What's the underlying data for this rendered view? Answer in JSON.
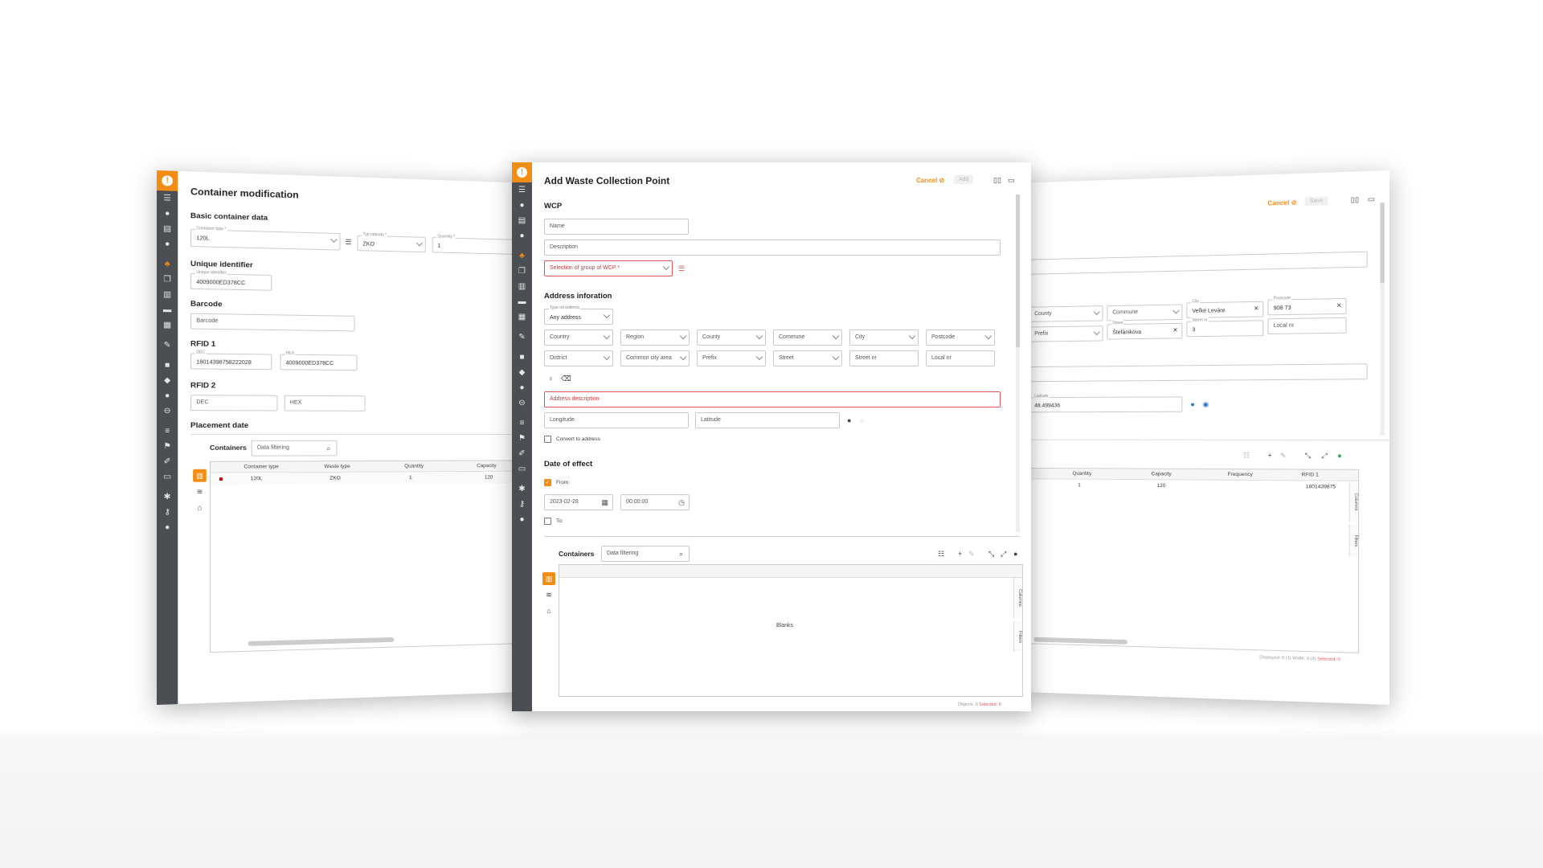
{
  "colors": {
    "accent": "#f28c13",
    "rail": "#4b4f53",
    "error": "#e05555"
  },
  "rail_icons": [
    "list-icon",
    "globe-icon",
    "document-icon",
    "info-icon",
    "waste-icon",
    "copy-icon",
    "bin-icon",
    "archive-icon",
    "calendar-icon",
    "magic-icon",
    "camera-icon",
    "tag-icon",
    "chat-icon",
    "minus-circle-icon",
    "sliders-icon",
    "flag-icon",
    "hammer-icon",
    "id-card-icon",
    "gear-icon",
    "key-icon",
    "user-icon"
  ],
  "left": {
    "title": "Container modification",
    "basic_section": "Basic container data",
    "container_type": {
      "label": "Container type *",
      "value": "120L"
    },
    "waste_type": {
      "label": "Typ odpadu *",
      "value": "ZKO"
    },
    "quantity": {
      "label": "Quantity *",
      "value": "1"
    },
    "unique_section": "Unique identifier",
    "unique_id": {
      "label": "Unique identifier",
      "value": "4009000ED378CC"
    },
    "barcode_section": "Barcode",
    "barcode_placeholder": "Barcode",
    "rfid1_section": "RFID 1",
    "rfid1_dec": {
      "label": "DEC",
      "value": "18014398758222028"
    },
    "rfid1_hex": {
      "label": "HEX",
      "value": "4009000ED378CC"
    },
    "rfid2_section": "RFID 2",
    "rfid2_dec_placeholder": "DEC",
    "rfid2_hex_placeholder": "HEX",
    "placement_section": "Placement date",
    "containers_label": "Containers",
    "filter_placeholder": "Data filtering",
    "columns": [
      "Container type",
      "Waste type",
      "Quantity",
      "Capacity"
    ],
    "row": [
      "120L",
      "ZKO",
      "1",
      "120"
    ]
  },
  "main": {
    "title": "Add Waste Collection Point",
    "cancel_label": "Cancel",
    "add_label": "Add",
    "wcp_section": "WCP",
    "name_placeholder": "Name",
    "description_placeholder": "Description",
    "group_placeholder": "Selection of group of WCP *",
    "address_section": "Address inforation",
    "type_address": {
      "label": "Type od address",
      "value": "Any address"
    },
    "row1": [
      "Country",
      "Region",
      "County",
      "Commune",
      "City",
      "Postcode"
    ],
    "row2": [
      "District",
      "Common city area",
      "Prefix",
      "Street",
      "Street nr",
      "Local nr"
    ],
    "address_description": "Address description",
    "longitude_placeholder": "Longitude",
    "latitude_placeholder": "Latitude",
    "convert_label": "Convert to address",
    "date_section": "Date of effect",
    "from_label": "From:",
    "from_date": "2023-02-28",
    "from_time": "00:00:00",
    "to_label": "To:",
    "containers_label": "Containers",
    "filter_placeholder": "Data filtering",
    "blanks_label": "Blanks",
    "columns_tab": "Columns",
    "filters_tab": "Filters",
    "objects_label": "Objects: 0",
    "selected_label": "Selected: 0"
  },
  "right": {
    "cancel_label": "Cancel",
    "save_label": "Save",
    "county_placeholder": "County",
    "commune_placeholder": "Commune",
    "city": {
      "label": "City",
      "value": "Veľké Leváre"
    },
    "postcode": {
      "label": "Postcode",
      "value": "908 73"
    },
    "prefix_placeholder": "Prefix",
    "street": {
      "label": "Street",
      "value": "Štefánikova"
    },
    "street_nr": {
      "label": "Street nr",
      "value": "3"
    },
    "local_nr_placeholder": "Local nr",
    "latitude": {
      "label": "Latitude",
      "value": "48.499436"
    },
    "columns": [
      "Quantity",
      "Capacity",
      "Frequency",
      "RFID 1"
    ],
    "row": [
      "1",
      "120",
      "",
      "1801439875"
    ],
    "columns_tab": "Columns",
    "filters_tab": "Filters",
    "footer": "Displayed: 0 (1) Width: 0 (4)",
    "footer_selected": "Selected: 0"
  }
}
